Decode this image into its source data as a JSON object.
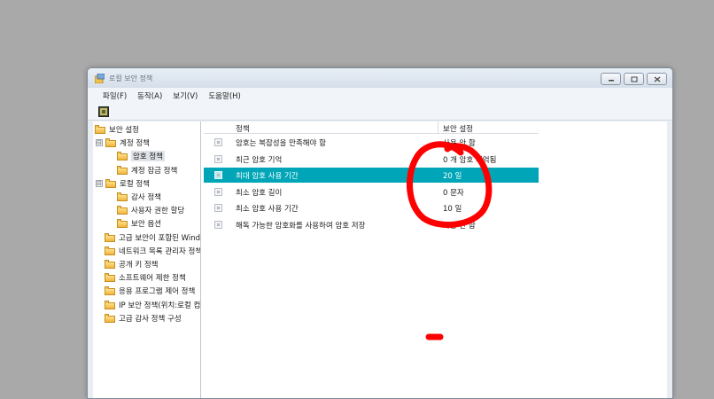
{
  "window": {
    "title": "로컬 보안 정책"
  },
  "menu": [
    "파일(F)",
    "동작(A)",
    "보기(V)",
    "도움말(H)"
  ],
  "tree": [
    {
      "label": "보안 설정",
      "level": 0,
      "expander": ""
    },
    {
      "label": "계정 정책",
      "level": 1,
      "expander": "⊟"
    },
    {
      "label": "암호 정책",
      "level": 2,
      "expander": "",
      "selected": true
    },
    {
      "label": "계정 잠금 정책",
      "level": 2,
      "expander": ""
    },
    {
      "label": "로컬 정책",
      "level": 1,
      "expander": "⊟"
    },
    {
      "label": "감사 정책",
      "level": 2,
      "expander": ""
    },
    {
      "label": "사용자 권한 할당",
      "level": 2,
      "expander": ""
    },
    {
      "label": "보안 옵션",
      "level": 2,
      "expander": ""
    },
    {
      "label": "고급 보안이 포함된 Windows 방화벽",
      "level": 1,
      "expander": ""
    },
    {
      "label": "네트워크 목록 관리자 정책",
      "level": 1,
      "expander": ""
    },
    {
      "label": "공개 키 정책",
      "level": 1,
      "expander": ""
    },
    {
      "label": "소프트웨어 제한 정책",
      "level": 1,
      "expander": ""
    },
    {
      "label": "응용 프로그램 제어 정책",
      "level": 1,
      "expander": ""
    },
    {
      "label": "IP 보안 정책(위치:로컬 컴퓨터)",
      "level": 1,
      "expander": "",
      "icon": "ip"
    },
    {
      "label": "고급 감사 정책 구성",
      "level": 1,
      "expander": ""
    }
  ],
  "list": {
    "headers": {
      "policy": "정책",
      "setting": "보안 설정"
    },
    "rows": [
      {
        "policy": "암호는 복잡성을 만족해야 함",
        "setting": "사용 안 함"
      },
      {
        "policy": "최근 암호 기억",
        "setting": "0 개 암호 기억됨"
      },
      {
        "policy": "최대 암호 사용 기간",
        "setting": "20 일",
        "selected": true
      },
      {
        "policy": "최소 암호 길이",
        "setting": "0 문자"
      },
      {
        "policy": "최소 암호 사용 기간",
        "setting": "10 일"
      },
      {
        "policy": "해독 가능한 암호화를 사용하여 암호 저장",
        "setting": "사용 안 함"
      }
    ]
  },
  "colors": {
    "selection": "#00a6b8",
    "annotation": "#ff0000"
  }
}
